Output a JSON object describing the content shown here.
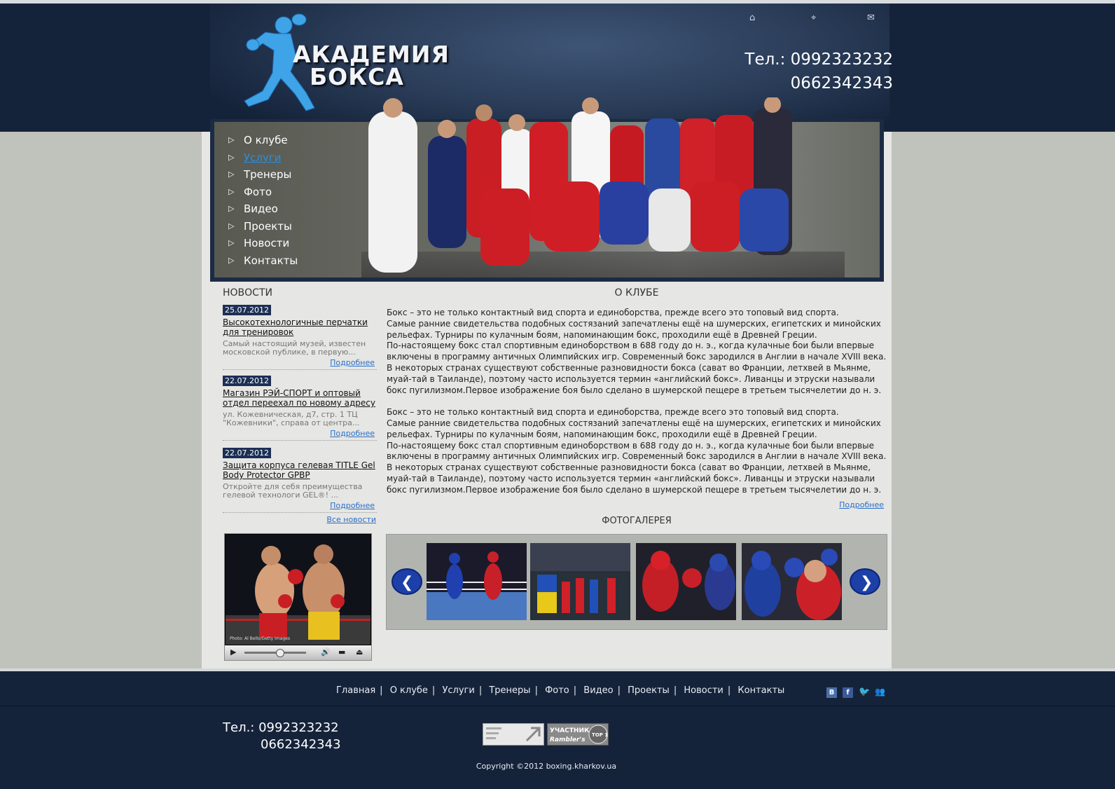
{
  "header": {
    "logo": {
      "line1": "АКАДЕМИЯ",
      "line2": "БОКСА"
    },
    "icons": [
      "home-icon",
      "sitemap-icon",
      "mail-icon"
    ],
    "phone1": "Тел.: 0992323232",
    "phone2": "0662342343"
  },
  "menu": {
    "items": [
      {
        "label": "О клубе",
        "active": false
      },
      {
        "label": "Услуги",
        "active": true
      },
      {
        "label": "Тренеры",
        "active": false
      },
      {
        "label": "Фото",
        "active": false
      },
      {
        "label": "Видео",
        "active": false
      },
      {
        "label": "Проекты",
        "active": false
      },
      {
        "label": "Новости",
        "active": false
      },
      {
        "label": "Контакты",
        "active": false
      }
    ]
  },
  "news": {
    "title": "НОВОСТИ",
    "items": [
      {
        "date": "25.07.2012",
        "headline": "Высокотехнологичные перчатки для тренировок",
        "desc": "Самый настоящий музей, известен московской публике, в первую...",
        "more": "Подробнее"
      },
      {
        "date": "22.07.2012",
        "headline": "Магазин РЭЙ-СПОРТ и оптовый отдел переехал по новому адресу",
        "desc": "ул. Кожевническая, д7, стр. 1 ТЦ \"Кожевники\", справа от центра...",
        "more": "Подробнее"
      },
      {
        "date": "22.07.2012",
        "headline": "Защита корпуса гелевая TITLE Gel Body Protector GPBP",
        "desc": "Откройте для себя преимущества гелевой технологи GEL®! ...",
        "more": "Подробнее"
      }
    ],
    "all": "Все новости"
  },
  "video": {
    "caption": "Photo: Al Bello/Getty Images"
  },
  "about": {
    "title": "О КЛУБЕ",
    "text": " Бокс – это не только контактный вид спорта и единоборства, прежде всего это топовый вид спорта.\nСамые ранние свидетельства подобных состязаний запечатлены ещё на шумерских, египетских и минойских рельефах. Турниры по кулачным боям, напоминающим бокс, проходили ещё в Древней Греции.\nПо-настоящему бокс стал спортивным единоборством в 688 году до н. э., когда кулачные бои были впервые включены в программу античных Олимпийских игр. Современный бокс зародился в Англии в начале XVIII века. В некоторых странах существуют собственные разновидности бокса (сават во Франции, летхвей в Мьянме, муай-тай в Таиланде), поэтому часто используется термин «английский бокс». Ливанцы и этруски называли бокс пугилизмом.Первое изображение боя было сделано в шумерской пещере в третьем тысячелетии до н. э.\n\n Бокс – это не только контактный вид спорта и единоборства, прежде всего это топовый вид спорта.\nСамые ранние свидетельства подобных состязаний запечатлены ещё на шумерских, египетских и минойских рельефах. Турниры по кулачным боям, напоминающим бокс, проходили ещё в Древней Греции.\nПо-настоящему бокс стал спортивным единоборством в 688 году до н. э., когда кулачные бои были впервые включены в программу античных Олимпийских игр. Современный бокс зародился в Англии в начале XVIII века. В некоторых странах существуют собственные разновидности бокса (сават во Франции, летхвей в Мьянме, муай-тай в Таиланде), поэтому часто используется термин «английский бокс». Ливанцы и этруски называли бокс пугилизмом.Первое изображение боя было сделано в шумерской пещере в третьем тысячелетии до н. э.",
    "more": "Подробнее"
  },
  "gallery": {
    "title": "ФОТОГАЛЕРЕЯ",
    "prev": "❮",
    "next": "❯"
  },
  "footer": {
    "nav": [
      "Главная",
      "О клубе",
      "Услуги",
      "Тренеры",
      "Фото",
      "Видео",
      "Проекты",
      "Новости",
      "Контакты"
    ],
    "social": {
      "vk": "B",
      "fb": "f"
    },
    "phone1": "Тел.: 0992323232",
    "phone2": "0662342343",
    "counter2_line1": "УЧАСТНИК",
    "counter2_line2": "Rambler's",
    "counter2_badge": "TOP 100",
    "copyright": "Copyright ©2012 boxing.kharkov.ua"
  }
}
